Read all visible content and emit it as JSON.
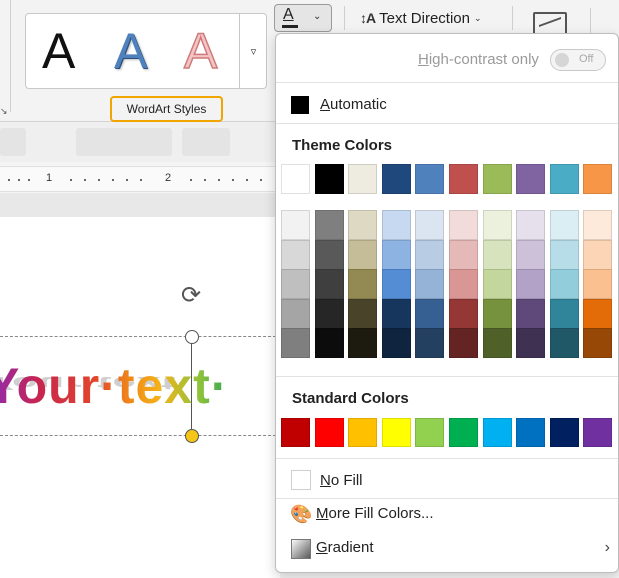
{
  "ribbon": {
    "wordart_samples": [
      "A",
      "A",
      "A"
    ],
    "gallery_more_glyph": "▿",
    "group_label": "WordArt Styles",
    "font_color_glyph": "A",
    "text_direction_label": "Text Direction",
    "launcher_glyph": "↘"
  },
  "document": {
    "ruler_numbers": [
      "1",
      "2"
    ],
    "wordart_text": "Your·text·",
    "rotate_glyph": "⟳"
  },
  "color_menu": {
    "high_contrast_label": "High-contrast only",
    "toggle_state": "Off",
    "automatic_label": "Automatic",
    "automatic_color": "#000000",
    "theme_colors_title": "Theme Colors",
    "theme_colors_top": [
      "#FFFFFF",
      "#000000",
      "#EEECE1",
      "#1F497D",
      "#4F81BD",
      "#C0504D",
      "#9BBB59",
      "#8064A2",
      "#4BACC6",
      "#F79646"
    ],
    "theme_colors_shades": [
      [
        "#F2F2F2",
        "#D8D8D8",
        "#BFBFBF",
        "#A5A5A5",
        "#7F7F7F"
      ],
      [
        "#7F7F7F",
        "#595959",
        "#3F3F3F",
        "#262626",
        "#0C0C0C"
      ],
      [
        "#DDD9C3",
        "#C4BD97",
        "#938953",
        "#494429",
        "#1D1B10"
      ],
      [
        "#C6D9F0",
        "#8DB3E2",
        "#548DD4",
        "#17365D",
        "#0F243E"
      ],
      [
        "#DBE5F1",
        "#B8CCE4",
        "#95B3D7",
        "#366092",
        "#244061"
      ],
      [
        "#F2DCDB",
        "#E5B9B7",
        "#D99694",
        "#953734",
        "#632423"
      ],
      [
        "#EBF1DD",
        "#D7E3BC",
        "#C3D69B",
        "#76923C",
        "#4F6128"
      ],
      [
        "#E5E0EC",
        "#CCC1D9",
        "#B2A2C7",
        "#5F497A",
        "#3F3151"
      ],
      [
        "#DBEEF3",
        "#B7DDE8",
        "#92CDDC",
        "#31859B",
        "#205867"
      ],
      [
        "#FDEADA",
        "#FBD5B5",
        "#FAC08F",
        "#E36C09",
        "#974806"
      ]
    ],
    "standard_colors_title": "Standard Colors",
    "standard_colors": [
      "#C00000",
      "#FF0000",
      "#FFC000",
      "#FFFF00",
      "#92D050",
      "#00B050",
      "#00B0F0",
      "#0070C0",
      "#002060",
      "#7030A0"
    ],
    "no_fill_label": "No Fill",
    "more_fill_colors_label": "More Fill Colors...",
    "gradient_label": "Gradient",
    "submenu_glyph": "›"
  }
}
